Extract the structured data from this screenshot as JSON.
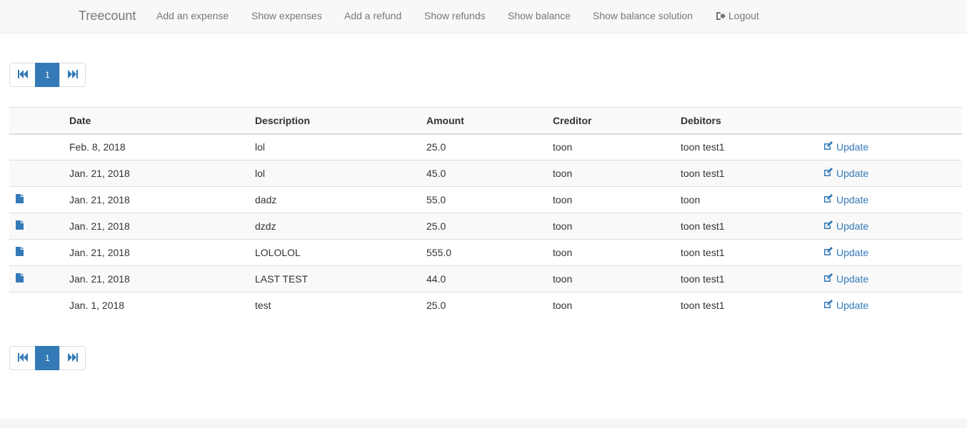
{
  "nav": {
    "brand": "Treecount",
    "links": [
      {
        "label": "Add an expense"
      },
      {
        "label": "Show expenses"
      },
      {
        "label": "Add a refund"
      },
      {
        "label": "Show refunds"
      },
      {
        "label": "Show balance"
      },
      {
        "label": "Show balance solution"
      },
      {
        "label": "Logout",
        "icon": "logout-icon"
      }
    ]
  },
  "pagination": {
    "first_icon": "fast-backward-icon",
    "current_page": "1",
    "last_icon": "fast-forward-icon"
  },
  "table": {
    "headers": [
      "",
      "Date",
      "Description",
      "Amount",
      "Creditor",
      "Debitors",
      ""
    ],
    "rows": [
      {
        "has_attachment": false,
        "date": "Feb. 8, 2018",
        "description": "lol",
        "amount": "25.0",
        "creditor": "toon",
        "debitors": "toon test1",
        "action": "Update"
      },
      {
        "has_attachment": false,
        "date": "Jan. 21, 2018",
        "description": "lol",
        "amount": "45.0",
        "creditor": "toon",
        "debitors": "toon test1",
        "action": "Update"
      },
      {
        "has_attachment": true,
        "date": "Jan. 21, 2018",
        "description": "dadz",
        "amount": "55.0",
        "creditor": "toon",
        "debitors": "toon",
        "action": "Update"
      },
      {
        "has_attachment": true,
        "date": "Jan. 21, 2018",
        "description": "dzdz",
        "amount": "25.0",
        "creditor": "toon",
        "debitors": "toon test1",
        "action": "Update"
      },
      {
        "has_attachment": true,
        "date": "Jan. 21, 2018",
        "description": "LOLOLOL",
        "amount": "555.0",
        "creditor": "toon",
        "debitors": "toon test1",
        "action": "Update"
      },
      {
        "has_attachment": true,
        "date": "Jan. 21, 2018",
        "description": "LAST TEST",
        "amount": "44.0",
        "creditor": "toon",
        "debitors": "toon test1",
        "action": "Update"
      },
      {
        "has_attachment": false,
        "date": "Jan. 1, 2018",
        "description": "test",
        "amount": "25.0",
        "creditor": "toon",
        "debitors": "toon test1",
        "action": "Update"
      }
    ]
  },
  "colors": {
    "link": "#337ab7",
    "nav_text": "#777777",
    "navbar_bg": "#f8f8f8"
  }
}
